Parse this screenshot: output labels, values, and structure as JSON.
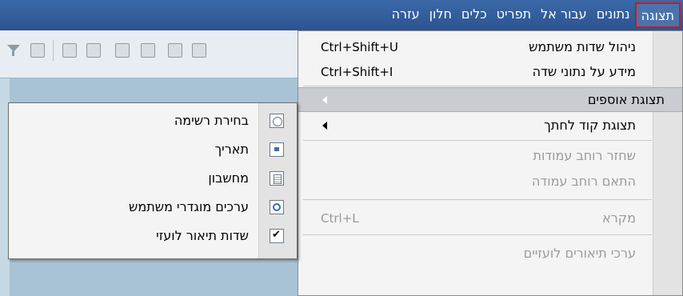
{
  "menubar": {
    "items": [
      {
        "label": "תצוגה",
        "active": true
      },
      {
        "label": "נתונים"
      },
      {
        "label": "עבור אל"
      },
      {
        "label": "תפריט"
      },
      {
        "label": "כלים"
      },
      {
        "label": "חלון"
      },
      {
        "label": "עזרה"
      }
    ]
  },
  "menu": {
    "items": [
      {
        "label": "ניהול שדות משתמש",
        "shortcut": "Ctrl+Shift+U"
      },
      {
        "label": "מידע על נתוני שדה",
        "shortcut": "Ctrl+Shift+I"
      },
      {
        "label": "תצוגת אוספים",
        "submenu": true,
        "highlighted": true
      },
      {
        "label": "תצוגת קוד לחתך",
        "submenu": true
      },
      {
        "label": "שחזר רוחב עמודות",
        "disabled": true
      },
      {
        "label": "התאם רוחב עמודה",
        "disabled": true
      },
      {
        "label": "מקרא",
        "shortcut": "Ctrl+L",
        "disabled": true
      },
      {
        "label": "ערכי תיאורים לועזיים",
        "disabled": true
      }
    ]
  },
  "submenu": {
    "items": [
      {
        "label": "בחירת רשימה",
        "icon": "list-icon"
      },
      {
        "label": "תאריך",
        "icon": "calendar-icon"
      },
      {
        "label": "מחשבון",
        "icon": "calculator-icon"
      },
      {
        "label": "ערכים מוגדרי משתמש",
        "icon": "search-icon"
      },
      {
        "label": "שדות תיאור לועזי",
        "icon": "checkmark-icon"
      }
    ]
  }
}
